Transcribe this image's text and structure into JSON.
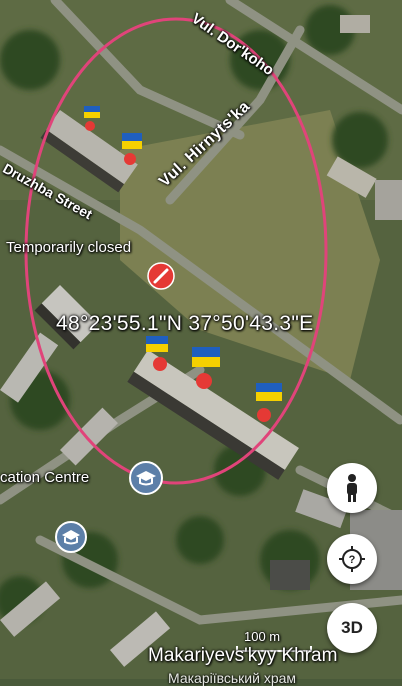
{
  "map": {
    "labels": {
      "street_top": "Vul. Dor'koho",
      "street_hirnytska": "Vul. Hirnyts'ka",
      "street_druzhba": "Druzhba Street",
      "temporarily_closed": "Temporarily closed",
      "education_centre": "cation Centre",
      "bottom_place": "Makariyevs'kyy Khram",
      "bottom_place_sub": "Макаріївський храм"
    },
    "coordinates": "48°23'55.1\"N 37°50'43.3\"E",
    "scale": "100 m"
  },
  "buttons": {
    "three_d": "3D"
  },
  "icons": {
    "pegman": "person-icon",
    "locate": "locate-icon",
    "closed": "no-entry-icon",
    "education": "graduation-cap-icon",
    "flag": "ukraine-flag-icon"
  },
  "colors": {
    "circle": "#e0447a",
    "flag_blue": "#1f5fbf",
    "flag_yellow": "#f5d000"
  }
}
